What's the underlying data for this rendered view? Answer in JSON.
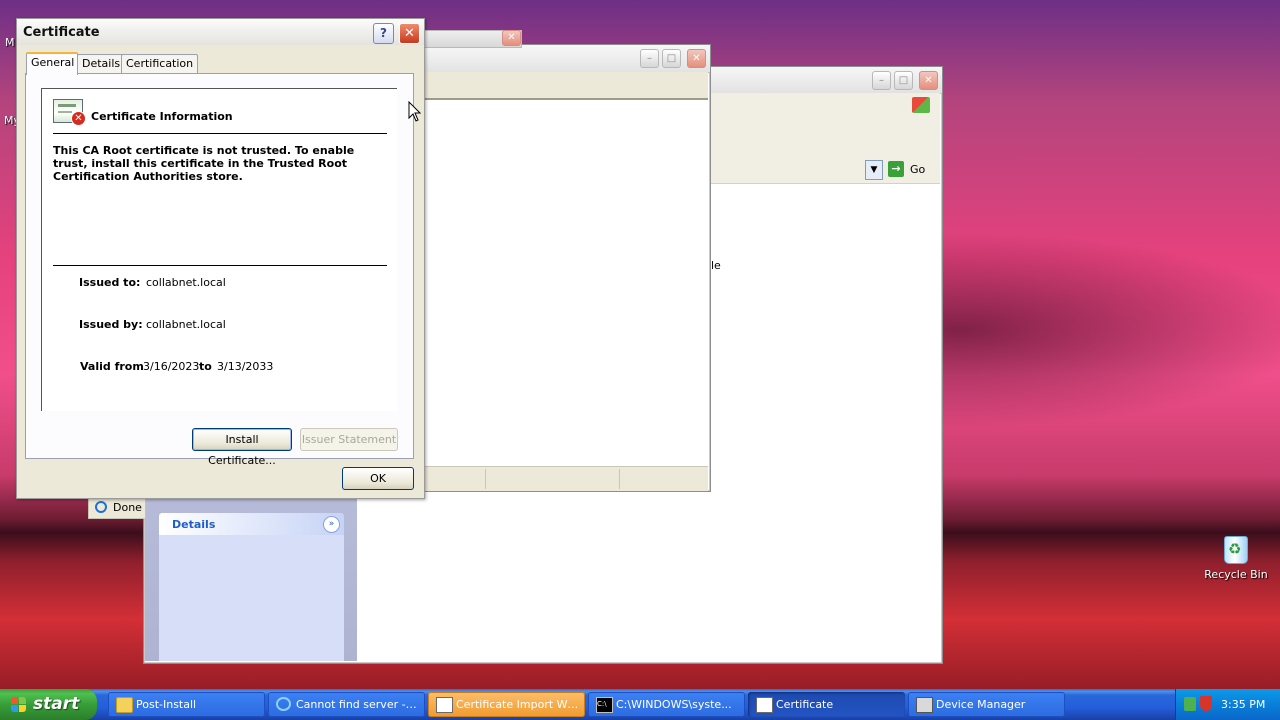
{
  "desktop": {
    "recycle_bin_label": "Recycle Bin",
    "left_icon_fragment_1": "M",
    "left_icon_fragment_2": "My"
  },
  "background_windows": {
    "explorer_status_text": "Done",
    "explorer_go_label": "Go",
    "details_panel_title": "Details",
    "partial_label": "le"
  },
  "certificate_dialog": {
    "title": "Certificate",
    "help_label": "?",
    "tabs": [
      "General",
      "Details",
      "Certification Path"
    ],
    "info_heading": "Certificate Information",
    "warning_text": "This CA Root certificate is not trusted. To enable trust, install this certificate in the Trusted Root Certification Authorities store.",
    "issued_to_label": "Issued to:",
    "issued_to_value": "collabnet.local",
    "issued_by_label": "Issued by:",
    "issued_by_value": "collabnet.local",
    "valid_from_label": "Valid from",
    "valid_from_value": "3/16/2023",
    "valid_to_label": "to",
    "valid_to_value": "3/13/2033",
    "install_button": "Install Certificate...",
    "issuer_statement_button": "Issuer Statement",
    "ok_button": "OK"
  },
  "taskbar": {
    "start_label": "start",
    "buttons": [
      {
        "label": "Post-Install",
        "icon": "folder-icon",
        "state": "normal"
      },
      {
        "label": "Cannot find server - ...",
        "icon": "ie-icon",
        "state": "normal"
      },
      {
        "label": "Certificate Import Wi...",
        "icon": "window-icon",
        "state": "flash"
      },
      {
        "label": "C:\\WINDOWS\\syste...",
        "icon": "cmd-icon",
        "state": "normal"
      },
      {
        "label": "Certificate",
        "icon": "window-icon",
        "state": "active"
      },
      {
        "label": "Device Manager",
        "icon": "device-manager-icon",
        "state": "normal"
      }
    ],
    "clock": "3:35 PM"
  },
  "colors": {
    "taskbar_blue": "#245edb",
    "start_green": "#3c9e3c",
    "tray_blue": "#0a7fd9",
    "close_red": "#c8391d"
  }
}
